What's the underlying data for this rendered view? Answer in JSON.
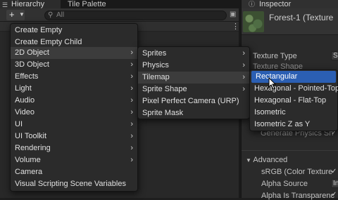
{
  "hierarchy": {
    "tabs": [
      {
        "label": "Hierarchy",
        "icon": "list-icon"
      },
      {
        "label": "Tile Palette"
      }
    ],
    "add_button_label": "+",
    "search_placeholder": "All"
  },
  "inspector": {
    "tab_label": "Inspector",
    "asset_title": "Forest-1 (Texture",
    "rows": [
      {
        "label": "Texture Type",
        "value": "S"
      },
      {
        "label": "Texture Shape"
      },
      {
        "label": "Generate Physics Sh"
      }
    ],
    "advanced": {
      "label": "Advanced",
      "rows": [
        {
          "label": "sRGB (Color Texture",
          "checked": true
        },
        {
          "label": "Alpha Source",
          "value": "In"
        },
        {
          "label": "Alpha Is Transparenc",
          "checked": true
        }
      ]
    }
  },
  "menu_main": {
    "items": [
      {
        "label": "Create Empty"
      },
      {
        "label": "Create Empty Child"
      },
      {
        "label": "2D Object",
        "submenu": true,
        "state": "open"
      },
      {
        "label": "3D Object",
        "submenu": true
      },
      {
        "label": "Effects",
        "submenu": true
      },
      {
        "label": "Light",
        "submenu": true
      },
      {
        "label": "Audio",
        "submenu": true
      },
      {
        "label": "Video",
        "submenu": true
      },
      {
        "label": "UI",
        "submenu": true
      },
      {
        "label": "UI Toolkit",
        "submenu": true
      },
      {
        "label": "Rendering",
        "submenu": true
      },
      {
        "label": "Volume",
        "submenu": true
      },
      {
        "label": "Camera"
      },
      {
        "label": "Visual Scripting Scene Variables"
      }
    ]
  },
  "menu_2d": {
    "items": [
      {
        "label": "Sprites",
        "submenu": true
      },
      {
        "label": "Physics",
        "submenu": true
      },
      {
        "label": "Tilemap",
        "submenu": true,
        "state": "open"
      },
      {
        "label": "Sprite Shape",
        "submenu": true
      },
      {
        "label": "Pixel Perfect Camera (URP)"
      },
      {
        "label": "Sprite Mask"
      }
    ]
  },
  "menu_tilemap": {
    "items": [
      {
        "label": "Rectangular",
        "state": "selected"
      },
      {
        "label": "Hexagonal - Pointed-Top"
      },
      {
        "label": "Hexagonal - Flat-Top"
      },
      {
        "label": "Isometric"
      },
      {
        "label": "Isometric Z as Y"
      }
    ]
  },
  "colors": {
    "panel": "#282828",
    "menu": "#2b2b2b",
    "selection": "#2b5fb3",
    "text": "#e0e0e0"
  }
}
